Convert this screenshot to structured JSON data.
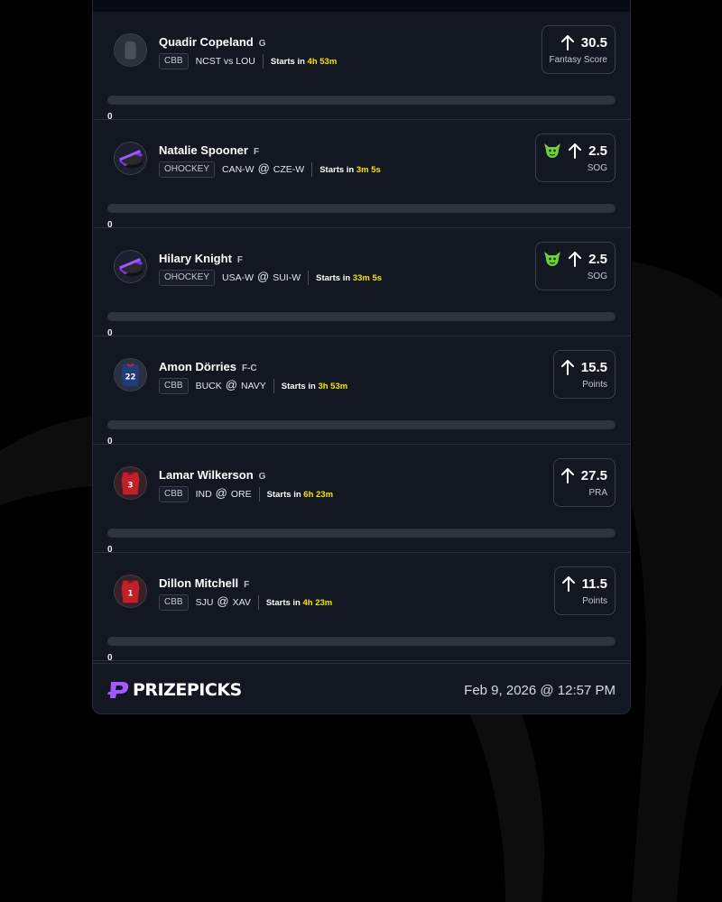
{
  "picks": [
    {
      "player": "Quadir Copeland",
      "position": "G",
      "league": "CBB",
      "team1": "NCST vs LOU",
      "team2": "",
      "starts_label": "Starts in",
      "starts_time": "4h 53m",
      "line": "30.5",
      "stat": "Fantasy Score",
      "goblin": false,
      "direction": "up",
      "avatar": "placeholder",
      "count": "0",
      "progress": 0
    },
    {
      "player": "Natalie Spooner",
      "position": "F",
      "league": "OHOCKEY",
      "team1": "CAN-W",
      "team2": "CZE-W",
      "starts_label": "Starts in",
      "starts_time": "3m 5s",
      "line": "2.5",
      "stat": "SOG",
      "goblin": true,
      "direction": "up",
      "avatar": "puck",
      "count": "0",
      "progress": 0
    },
    {
      "player": "Hilary Knight",
      "position": "F",
      "league": "OHOCKEY",
      "team1": "USA-W",
      "team2": "SUI-W",
      "starts_label": "Starts in",
      "starts_time": "33m 5s",
      "line": "2.5",
      "stat": "SOG",
      "goblin": true,
      "direction": "up",
      "avatar": "puck",
      "count": "0",
      "progress": 0
    },
    {
      "player": "Amon Dörries",
      "position": "F-C",
      "league": "CBB",
      "team1": "BUCK",
      "team2": "NAVY",
      "starts_label": "Starts in",
      "starts_time": "3h 53m",
      "line": "15.5",
      "stat": "Points",
      "goblin": false,
      "direction": "up",
      "avatar": "jersey-navy",
      "jersey_number": "22",
      "count": "0",
      "progress": 0
    },
    {
      "player": "Lamar Wilkerson",
      "position": "G",
      "league": "CBB",
      "team1": "IND",
      "team2": "ORE",
      "starts_label": "Starts in",
      "starts_time": "6h 23m",
      "line": "27.5",
      "stat": "PRA",
      "goblin": false,
      "direction": "up",
      "avatar": "jersey-red",
      "jersey_number": "3",
      "count": "0",
      "progress": 0
    },
    {
      "player": "Dillon Mitchell",
      "position": "F",
      "league": "CBB",
      "team1": "SJU",
      "team2": "XAV",
      "starts_label": "Starts in",
      "starts_time": "4h 23m",
      "line": "11.5",
      "stat": "Points",
      "goblin": false,
      "direction": "up",
      "avatar": "jersey-red",
      "jersey_number": "1",
      "count": "0",
      "progress": 0
    }
  ],
  "footer": {
    "brand": "PRIZEPICKS",
    "logo_icon": "prizepicks-logo-icon",
    "date": "Feb 9, 2026 @ 12:57 PM"
  },
  "colors": {
    "accent_time": "#f4e600",
    "goblin": "#6fd13a",
    "logo": "#a259ff",
    "card_bg": "#131722"
  }
}
